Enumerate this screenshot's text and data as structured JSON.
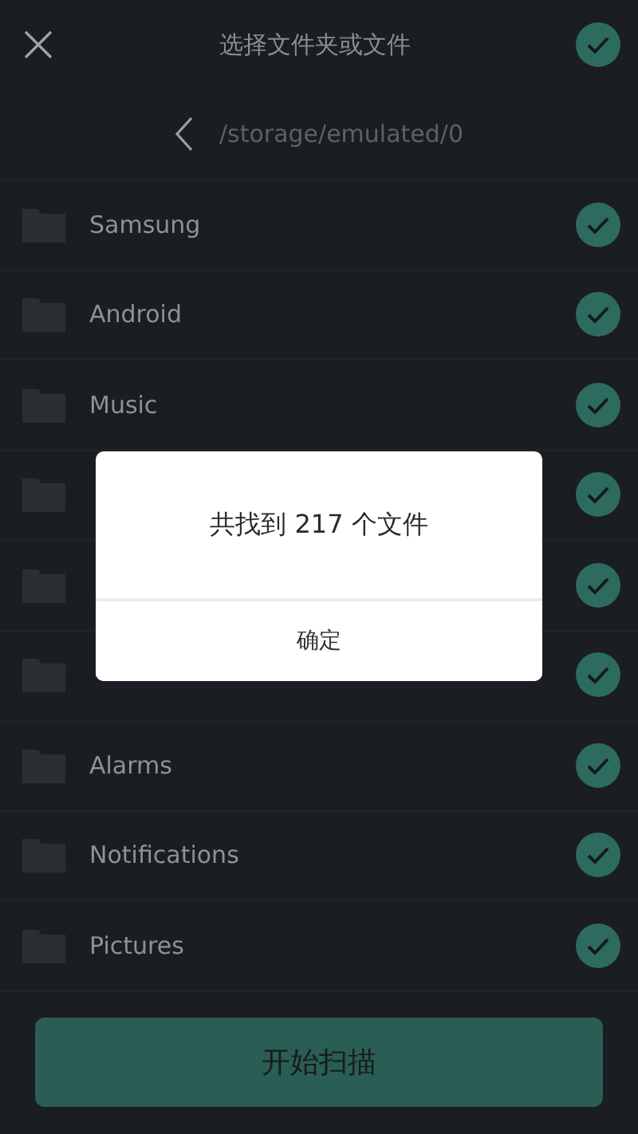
{
  "header": {
    "title": "选择文件夹或文件",
    "all_checked": true
  },
  "path": "/storage/emulated/0",
  "folders": [
    {
      "name": "Samsung",
      "checked": true
    },
    {
      "name": "Android",
      "checked": true
    },
    {
      "name": "Music",
      "checked": true
    },
    {
      "checked": true
    },
    {
      "checked": true
    },
    {
      "checked": true
    },
    {
      "name": "Alarms",
      "checked": true
    },
    {
      "name": "Notifications",
      "checked": true
    },
    {
      "name": "Pictures",
      "checked": true
    }
  ],
  "dialog": {
    "message": "共找到 217 个文件",
    "button": "确定"
  },
  "scan_button": "开始扫描"
}
